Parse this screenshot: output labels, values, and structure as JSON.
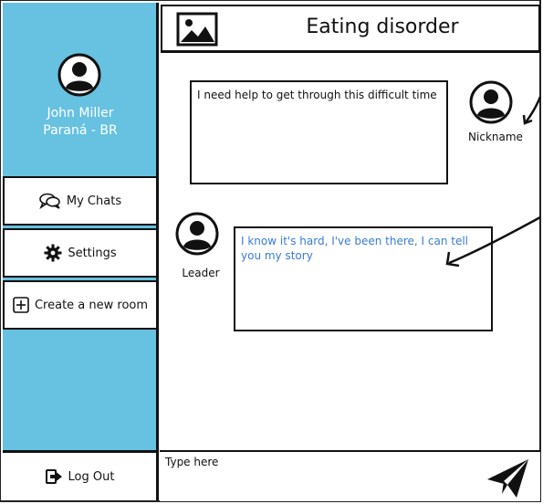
{
  "profile": {
    "name": "John Miller",
    "location": "Paraná - BR"
  },
  "nav": {
    "my_chats": "My Chats",
    "settings": "Settings",
    "create_room": "Create a new room",
    "log_out": "Log Out"
  },
  "header": {
    "title": "Eating disorder"
  },
  "messages": [
    {
      "author": "Nickname",
      "text": "I need help to get through this difficult time"
    },
    {
      "author": "Leader",
      "text": "I know it's hard, I've been there, I can tell you my story"
    }
  ],
  "input": {
    "placeholder": "Type here"
  },
  "colors": {
    "sidebar": "#67c1e0",
    "leader_text": "#3a7bd5"
  }
}
